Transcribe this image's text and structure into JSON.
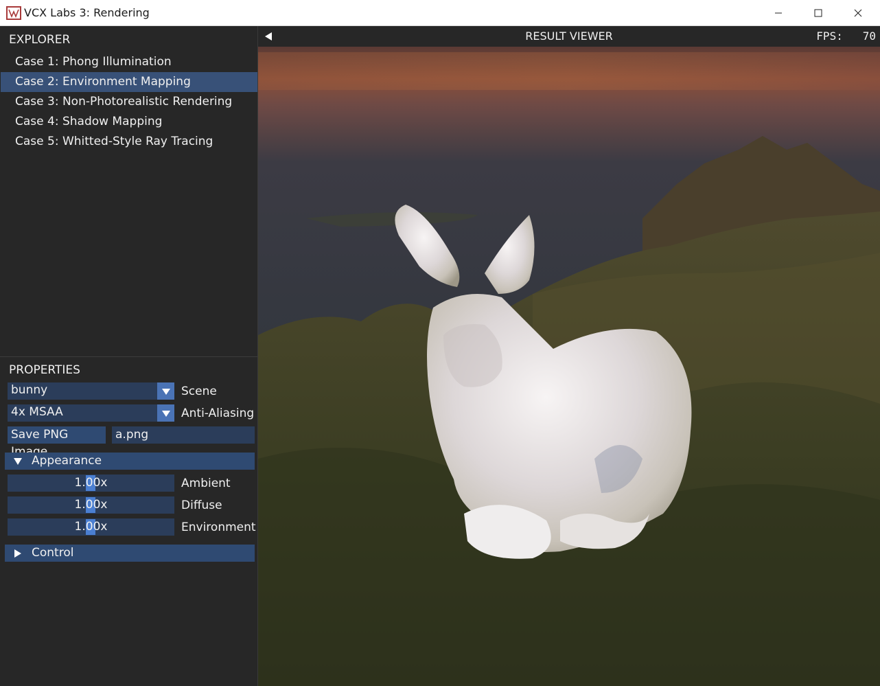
{
  "window": {
    "title": "VCX Labs 3: Rendering",
    "icon": "app-logo-icon",
    "controls": [
      "minimize-icon",
      "maximize-icon",
      "close-icon"
    ]
  },
  "explorer": {
    "title": "EXPLORER",
    "cases": [
      {
        "label": "Case 1: Phong Illumination",
        "selected": false
      },
      {
        "label": "Case 2: Environment Mapping",
        "selected": true
      },
      {
        "label": "Case 3: Non-Photorealistic Rendering",
        "selected": false
      },
      {
        "label": "Case 4: Shadow Mapping",
        "selected": false
      },
      {
        "label": "Case 5: Whitted-Style Ray Tracing",
        "selected": false
      }
    ]
  },
  "properties": {
    "title": "PROPERTIES",
    "scene": {
      "value": "bunny",
      "label": "Scene"
    },
    "antialiasing": {
      "value": "4x MSAA",
      "label": "Anti-Aliasing"
    },
    "save_button": "Save PNG Image",
    "filename": "a.png",
    "appearance": {
      "label": "Appearance",
      "expanded": true,
      "sliders": [
        {
          "value": "1.00x",
          "label": "Ambient"
        },
        {
          "value": "1.00x",
          "label": "Diffuse"
        },
        {
          "value": "1.00x",
          "label": "Environment"
        }
      ]
    },
    "control": {
      "label": "Control",
      "expanded": false
    }
  },
  "viewer": {
    "title": "RESULT VIEWER",
    "fps_label": "FPS:",
    "fps_value": "70"
  },
  "colors": {
    "panel_bg": "#272727",
    "selected_bg": "#385178",
    "widget_bg": "#2b3d5a",
    "accent": "#4a73b5"
  }
}
